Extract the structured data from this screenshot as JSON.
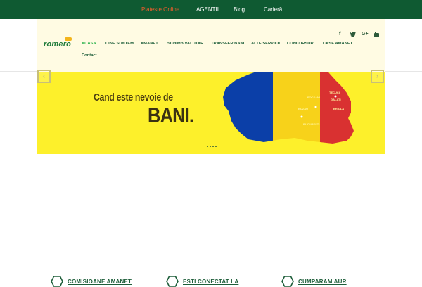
{
  "topbar": {
    "links": [
      {
        "label": "Plateste Online",
        "active": true
      },
      {
        "label": "AGENTII",
        "active": false
      },
      {
        "label": "Blog",
        "active": false
      },
      {
        "label": "Carieră",
        "active": false
      }
    ]
  },
  "header": {
    "logo_text": "romero",
    "nav": [
      {
        "label": "ACASA",
        "active": true
      },
      {
        "label": "CINE SUNTEM",
        "active": false
      },
      {
        "label": "AMANET",
        "active": false
      },
      {
        "label": "SCHIMB VALUTAR",
        "active": false
      },
      {
        "label": "TRANSFER BANI",
        "active": false
      },
      {
        "label": "ALTE SERVICII",
        "active": false
      },
      {
        "label": "CONCURSURI",
        "active": false
      },
      {
        "label": "CASE AMANET",
        "active": false
      },
      {
        "label": "Contact",
        "active": false
      }
    ],
    "social": [
      {
        "icon": "facebook-icon",
        "glyph": "f"
      },
      {
        "icon": "twitter-icon",
        "glyph": "🐦"
      },
      {
        "icon": "google-plus-icon",
        "glyph": "G+"
      },
      {
        "icon": "youtube-icon",
        "glyph": "▶"
      }
    ]
  },
  "hero": {
    "line1": "Cand este nevoie de",
    "line2": "BANI.",
    "prev_glyph": "‹",
    "next_glyph": "›",
    "map_labels": [
      "TECUCI",
      "FOCSANI",
      "GALATI",
      "BUZAU",
      "BRAILA",
      "BUCURESTI"
    ],
    "colors": {
      "background": "#fdf02b",
      "blue": "#0b3fa8",
      "yellow": "#f7d21a",
      "red": "#d93131"
    }
  },
  "features": [
    {
      "title": "COMISIOANE AMANET"
    },
    {
      "title": "ESTI CONECTAT LA"
    },
    {
      "title": "CUMPARAM AUR"
    }
  ],
  "colors": {
    "topbar": "#0f5a32",
    "accent": "#2bb24c",
    "topbar_active": "#ee5d2c"
  }
}
